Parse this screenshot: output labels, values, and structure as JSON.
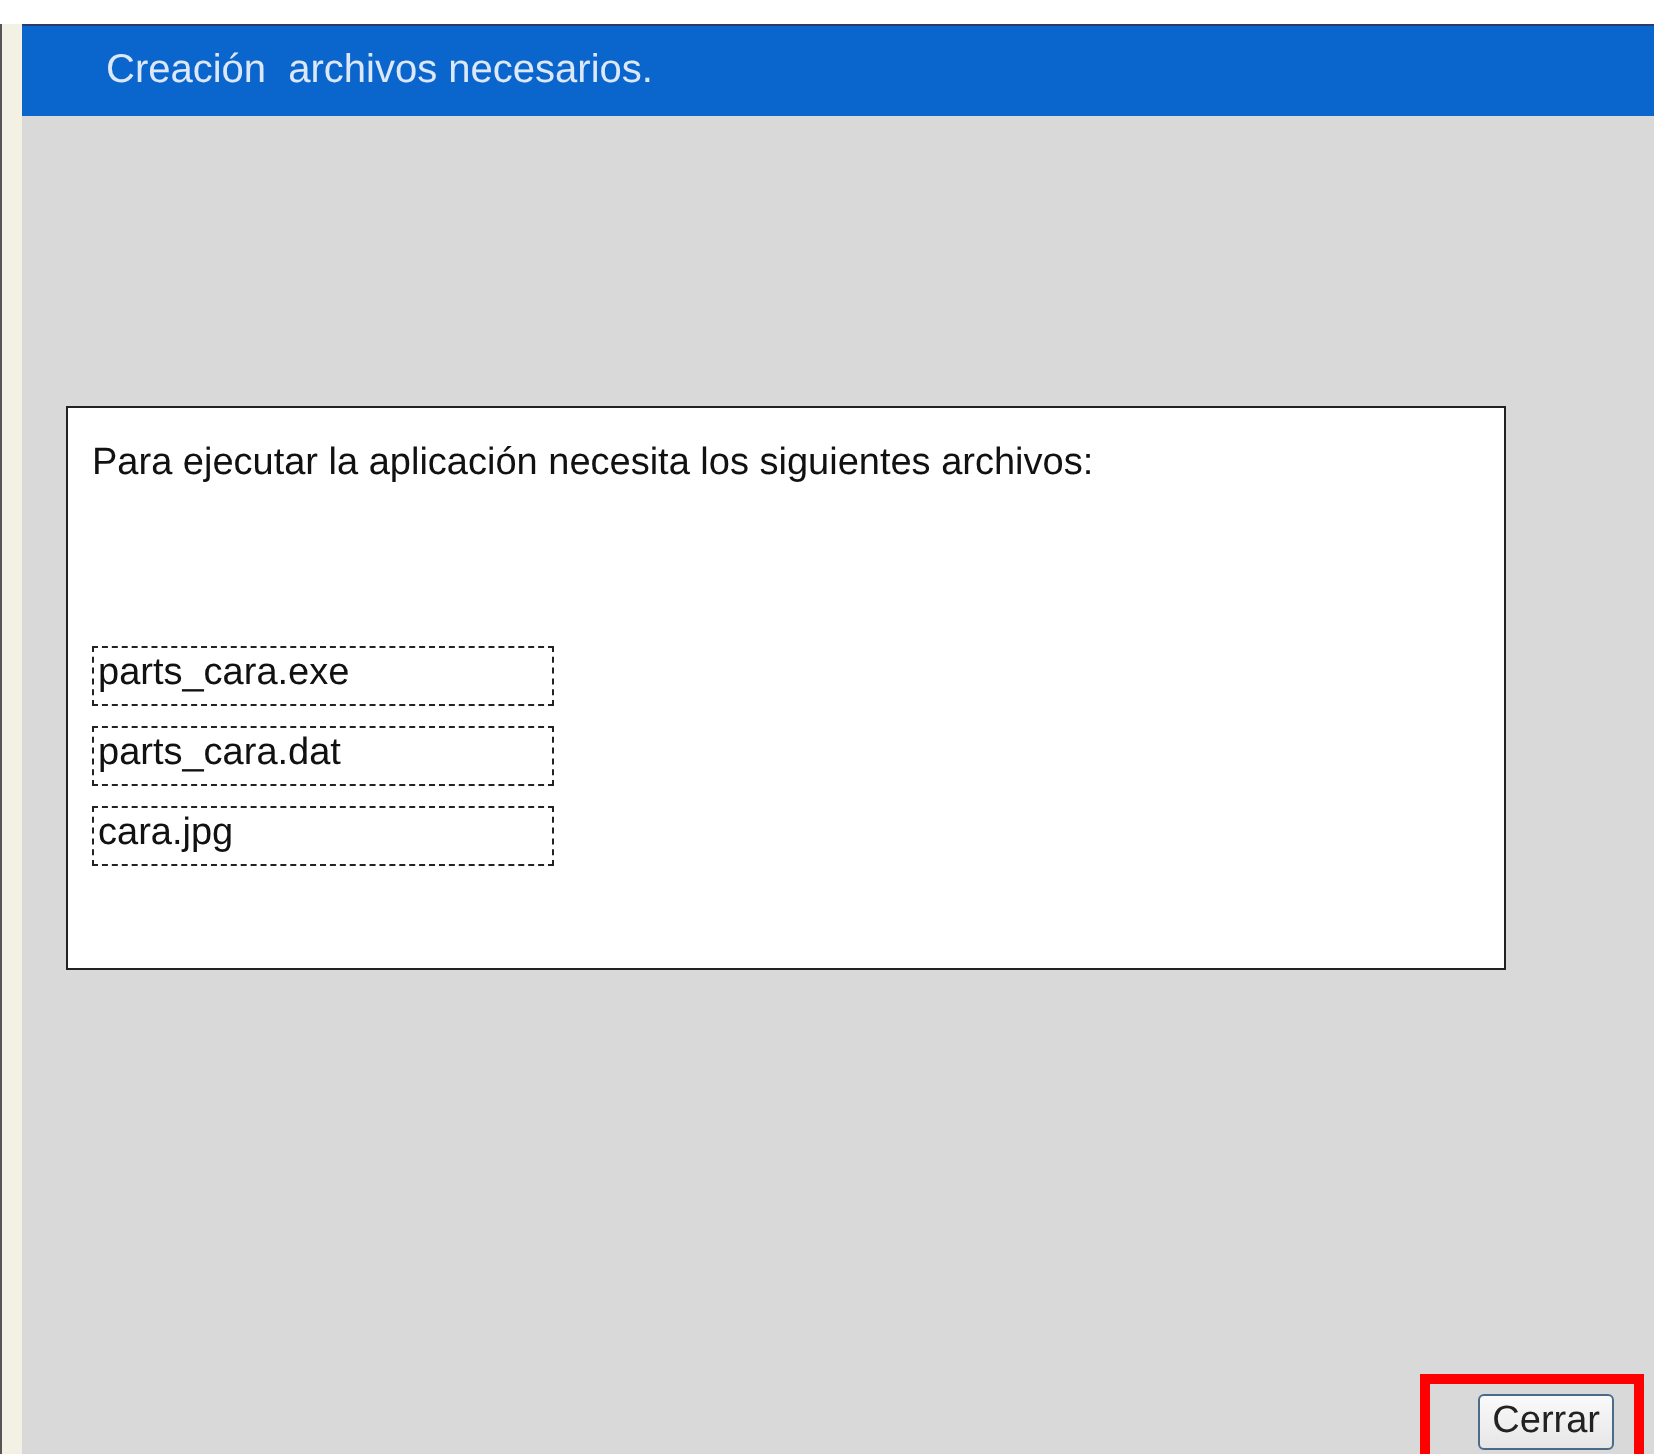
{
  "window": {
    "title": "Creación  archivos necesarios."
  },
  "message": "Para ejecutar la aplicación necesita los siguientes archivos:",
  "files": [
    {
      "name": "parts_cara.exe"
    },
    {
      "name": "parts_cara.dat"
    },
    {
      "name": "cara.jpg"
    }
  ],
  "buttons": [
    {
      "label": "Cerrar",
      "highlighted": true
    }
  ]
}
